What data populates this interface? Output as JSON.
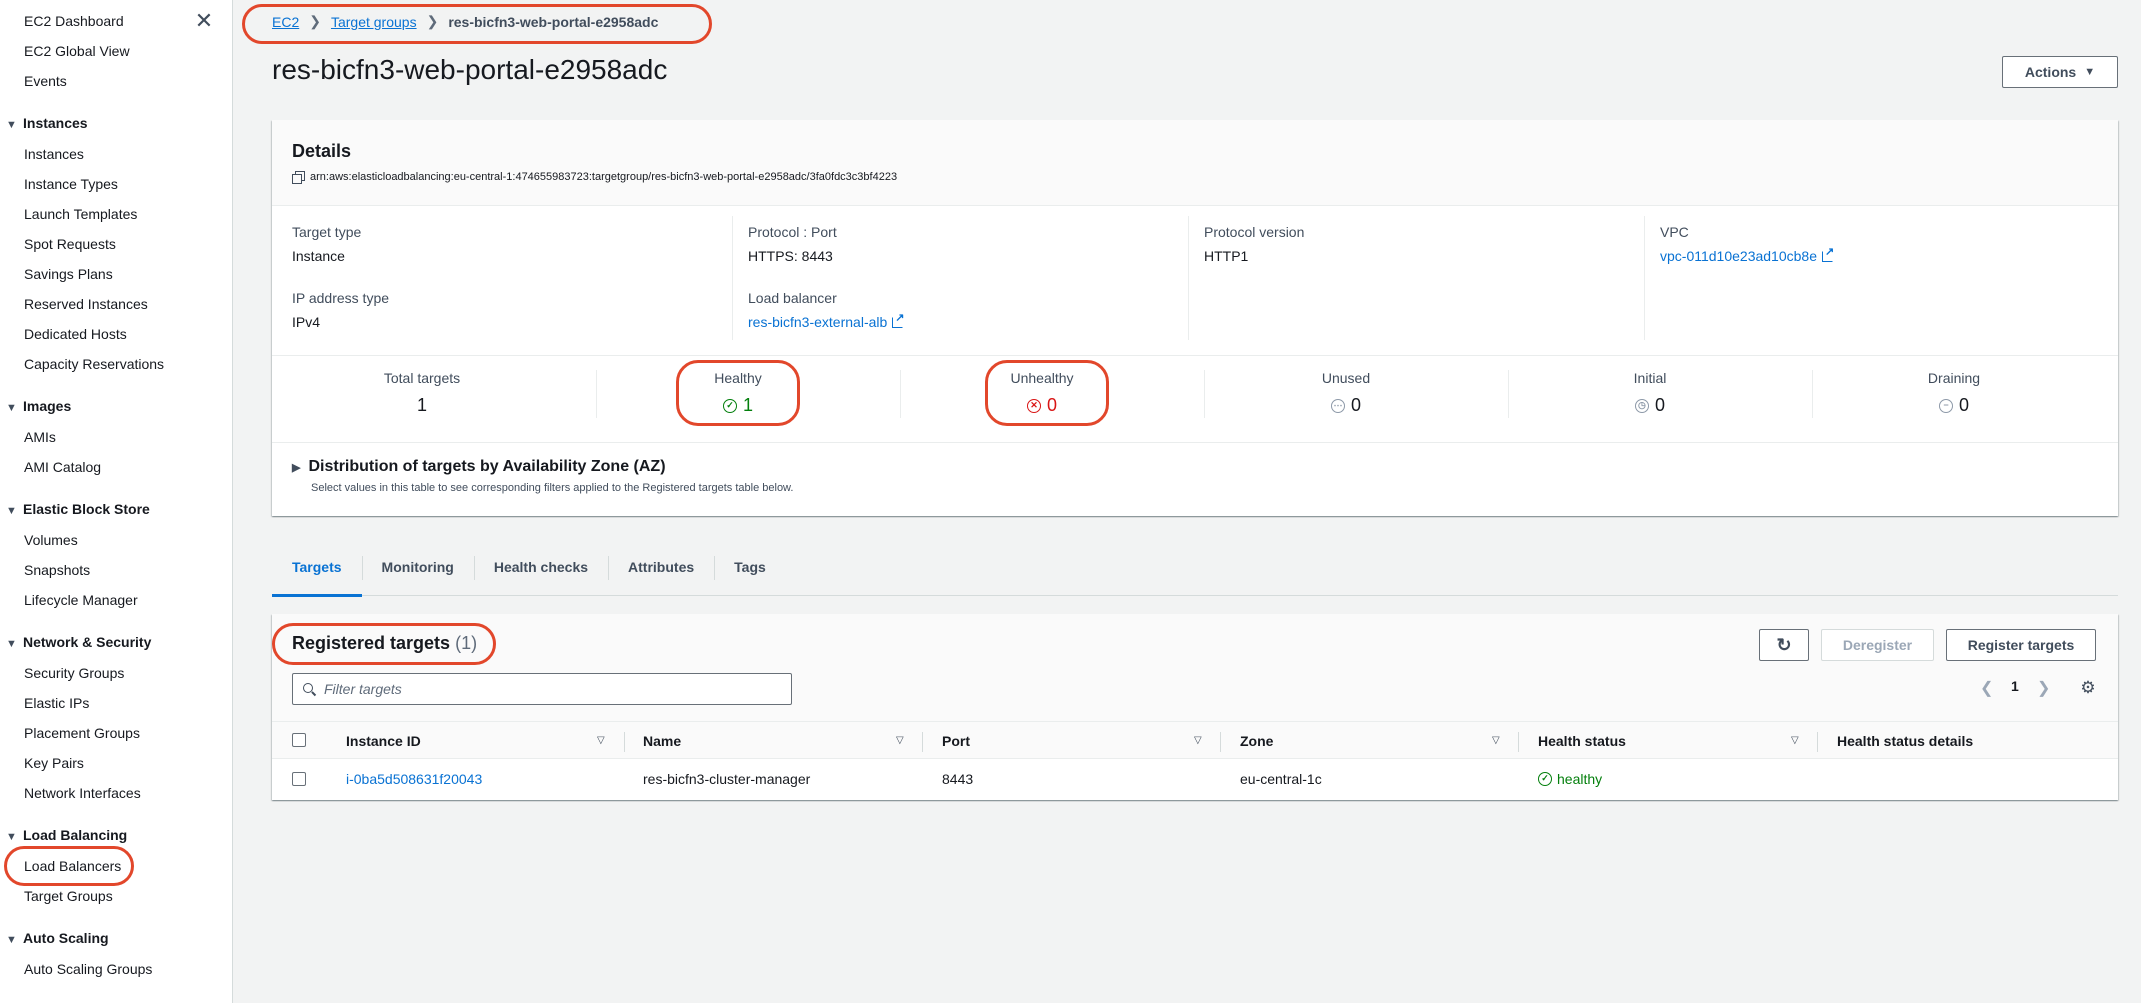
{
  "sidebar": {
    "top_items": [
      "EC2 Dashboard",
      "EC2 Global View",
      "Events"
    ],
    "sections": {
      "instances": {
        "title": "Instances",
        "items": [
          "Instances",
          "Instance Types",
          "Launch Templates",
          "Spot Requests",
          "Savings Plans",
          "Reserved Instances",
          "Dedicated Hosts",
          "Capacity Reservations"
        ]
      },
      "images": {
        "title": "Images",
        "items": [
          "AMIs",
          "AMI Catalog"
        ]
      },
      "ebs": {
        "title": "Elastic Block Store",
        "items": [
          "Volumes",
          "Snapshots",
          "Lifecycle Manager"
        ]
      },
      "network": {
        "title": "Network & Security",
        "items": [
          "Security Groups",
          "Elastic IPs",
          "Placement Groups",
          "Key Pairs",
          "Network Interfaces"
        ]
      },
      "lb": {
        "title": "Load Balancing",
        "items": [
          "Load Balancers",
          "Target Groups"
        ]
      },
      "autoscaling": {
        "title": "Auto Scaling",
        "items": [
          "Auto Scaling Groups"
        ]
      }
    }
  },
  "breadcrumb": {
    "ec2": "EC2",
    "target_groups": "Target groups",
    "current": "res-bicfn3-web-portal-e2958adc"
  },
  "page": {
    "title": "res-bicfn3-web-portal-e2958adc",
    "actions_label": "Actions"
  },
  "details": {
    "title": "Details",
    "arn": "arn:aws:elasticloadbalancing:eu-central-1:474655983723:targetgroup/res-bicfn3-web-portal-e2958adc/3fa0fdc3c3bf4223",
    "target_type_label": "Target type",
    "target_type_value": "Instance",
    "protocol_port_label": "Protocol : Port",
    "protocol_port_value": "HTTPS: 8443",
    "protocol_version_label": "Protocol version",
    "protocol_version_value": "HTTP1",
    "vpc_label": "VPC",
    "vpc_value": "vpc-011d10e23ad10cb8e",
    "ip_type_label": "IP address type",
    "ip_type_value": "IPv4",
    "lb_label": "Load balancer",
    "lb_value": "res-bicfn3-external-alb"
  },
  "stats": {
    "total": {
      "label": "Total targets",
      "value": "1"
    },
    "healthy": {
      "label": "Healthy",
      "value": "1"
    },
    "unhealthy": {
      "label": "Unhealthy",
      "value": "0"
    },
    "unused": {
      "label": "Unused",
      "value": "0"
    },
    "initial": {
      "label": "Initial",
      "value": "0"
    },
    "draining": {
      "label": "Draining",
      "value": "0"
    }
  },
  "az": {
    "title": "Distribution of targets by Availability Zone (AZ)",
    "description": "Select values in this table to see corresponding filters applied to the Registered targets table below."
  },
  "tabs": [
    "Targets",
    "Monitoring",
    "Health checks",
    "Attributes",
    "Tags"
  ],
  "registered": {
    "title": "Registered targets",
    "count": "(1)",
    "deregister_label": "Deregister",
    "register_label": "Register targets",
    "filter_placeholder": "Filter targets",
    "page": "1",
    "columns": [
      "Instance ID",
      "Name",
      "Port",
      "Zone",
      "Health status",
      "Health status details"
    ],
    "rows": [
      {
        "instance_id": "i-0ba5d508631f20043",
        "name": "res-bicfn3-cluster-manager",
        "port": "8443",
        "zone": "eu-central-1c",
        "health": "healthy",
        "details": ""
      }
    ]
  },
  "colors": {
    "link": "#0972d3",
    "healthy": "#037f0c",
    "unhealthy": "#d91515",
    "annotation": "#e2472b"
  },
  "icons": [
    "close-icon",
    "caret-down-icon",
    "copy-icon",
    "external-link-icon",
    "check-circle-icon",
    "error-circle-icon",
    "pending-circle-icon",
    "clock-circle-icon",
    "minus-circle-icon",
    "refresh-icon",
    "search-icon",
    "chevron-left-icon",
    "chevron-right-icon",
    "gear-icon",
    "sort-icon"
  ]
}
